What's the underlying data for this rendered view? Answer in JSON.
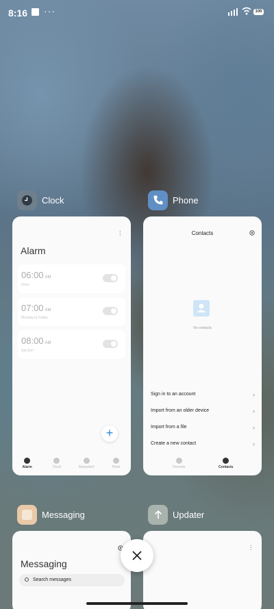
{
  "status_bar": {
    "time": "8:16",
    "overflow_icon": "more-dots-icon",
    "signal_icon": "signal-bars-icon",
    "wifi_icon": "wifi-icon",
    "battery_text": "100"
  },
  "recents": {
    "apps": [
      {
        "name": "Clock",
        "icon": "clock-icon",
        "icon_color": "#6f7f8c",
        "screen": {
          "title": "Alarm",
          "alarms": [
            {
              "time": "06:00",
              "ampm": "AM",
              "repeat": "Once",
              "enabled": false
            },
            {
              "time": "07:00",
              "ampm": "AM",
              "repeat": "Monday to Friday",
              "enabled": false
            },
            {
              "time": "08:00",
              "ampm": "AM",
              "repeat": "Sat,Sun",
              "enabled": false
            }
          ],
          "add_label": "+",
          "nav": [
            {
              "label": "Alarm",
              "active": true
            },
            {
              "label": "Clock",
              "active": false
            },
            {
              "label": "Stopwatch",
              "active": false
            },
            {
              "label": "Timer",
              "active": false
            }
          ]
        }
      },
      {
        "name": "Phone",
        "icon": "phone-icon",
        "icon_color": "#5f8fc4",
        "screen": {
          "title": "Contacts",
          "empty_text": "No contacts",
          "options": [
            "Sign in to an account",
            "Import from an older device",
            "Import from a file",
            "Create a new contact"
          ],
          "nav": [
            {
              "label": "Recents",
              "active": false
            },
            {
              "label": "Contacts",
              "active": true
            }
          ]
        }
      },
      {
        "name": "Messaging",
        "icon": "messaging-icon",
        "icon_color": "#e9c9a8",
        "screen": {
          "title": "Messaging",
          "search_label": "Search messages"
        }
      },
      {
        "name": "Updater",
        "icon": "arrow-up-icon",
        "icon_color": "#a9b3ad"
      }
    ]
  },
  "actions": {
    "close_all_label": "×"
  }
}
